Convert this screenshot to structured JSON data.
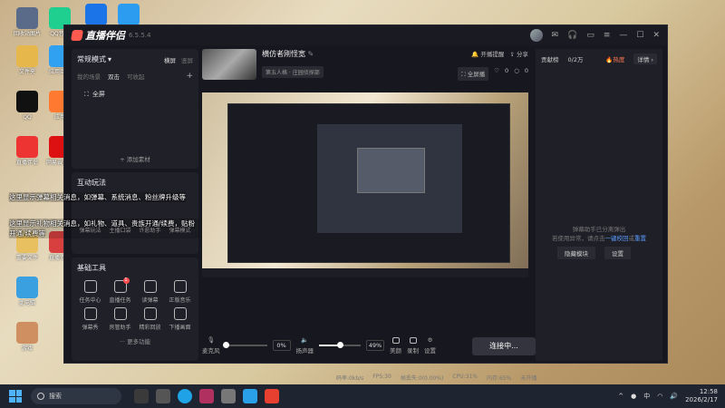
{
  "desktop": {
    "icons": [
      {
        "label": "回收站图片",
        "color": "#5a6b8a"
      },
      {
        "label": "QQ音乐",
        "color": "#1fcf8f"
      },
      {
        "label": "",
        "color": "#1b74e8"
      },
      {
        "label": "",
        "color": "#2b9cf0"
      },
      {
        "label": "文件夹",
        "color": "#e6b84c"
      },
      {
        "label": "应用商店",
        "color": "#30a0f0"
      },
      {
        "label": "QQ",
        "color": "#111"
      },
      {
        "label": "应用",
        "color": "#ff7a30"
      },
      {
        "label": "直播伴侣",
        "color": "#e33"
      },
      {
        "label": "网易云音乐",
        "color": "#d11"
      },
      {
        "label": "重要文件",
        "color": "#e8c060"
      },
      {
        "label": "直播资源",
        "color": "#d84040"
      },
      {
        "label": "此电脑",
        "color": "#3aa0e0"
      },
      {
        "label": "游戏",
        "color": "#cf8f60"
      }
    ]
  },
  "app": {
    "name": "直播伴侣",
    "version": "6.5.5.4",
    "left": {
      "mode_label": "常规模式",
      "layout_tabs": [
        "横屏",
        "竖屏"
      ],
      "scene_tabs": [
        "我的场景",
        "双击",
        "可收起"
      ],
      "scene_item": "全屏",
      "add_material": "添加素材",
      "interact_title": "互动玩法",
      "interact_tools": [
        "弹幕玩法",
        "主播口袋",
        "许愿助手",
        "弹幕模式"
      ],
      "basic_title": "基础工具",
      "basic_tools": [
        {
          "label": "任务中心",
          "badge": ""
        },
        {
          "label": "直播任务",
          "badge": "1"
        },
        {
          "label": "读弹幕",
          "badge": ""
        },
        {
          "label": "正版音乐",
          "badge": ""
        },
        {
          "label": "弹幕秀",
          "badge": ""
        },
        {
          "label": "房管助手",
          "badge": ""
        },
        {
          "label": "精彩回放",
          "badge": ""
        },
        {
          "label": "下播画面",
          "badge": ""
        }
      ],
      "more": "更多功能"
    },
    "overlay": {
      "line1": "这里显示弹幕相关消息，如弹幕、系统消息、粉丝牌升级等",
      "line2": "这里显示礼物相关消息，如礼物、道具、贵族开通/续费，贴粉开通/续费等"
    },
    "center": {
      "stream_title": "横仿者刚怪宽",
      "category": "第五人格 · 庄园侦探部",
      "announce": "开播提醒",
      "share": "分享",
      "fullscreen": "全屏播",
      "likes": "0",
      "comments": "0",
      "mic_label": "麦克风",
      "mic_pct": "0%",
      "speaker_label": "扬声器",
      "speaker_pct": "49%",
      "beauty_label": "美颜",
      "record_label": "录制",
      "settings_label": "设置",
      "connect_label": "连接中...",
      "mic_level": 0,
      "speaker_level": 0.49
    },
    "status": [
      "码率:0kb/s",
      "FPS:30",
      "帧丢失:0(0.00%)",
      "CPU:31%",
      "内存:65%",
      "未开播"
    ],
    "right": {
      "contribution": "贡献榜",
      "fans": "0/2万",
      "hot": "热度",
      "detail": "详情",
      "msg1": "弹幕助手已分离弹出",
      "msg2_pre": "若使用异常，请点击",
      "msg2_link1": "一键校回",
      "msg2_mid": "或",
      "msg2_link2": "重置",
      "btn_hide": "隐藏模块",
      "btn_settings": "设置"
    }
  },
  "taskbar": {
    "search": "搜索",
    "tray_lang": "中",
    "time": "12:58",
    "date": "2026/2/17"
  }
}
